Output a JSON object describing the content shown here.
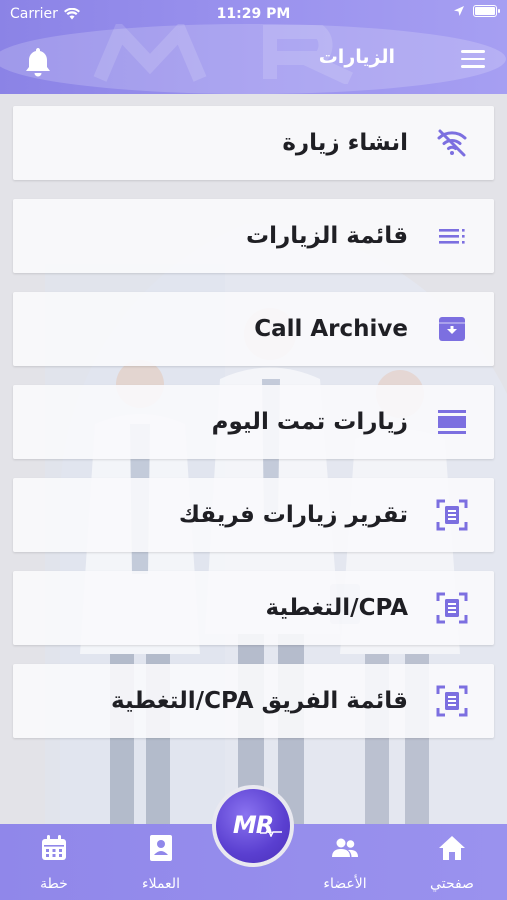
{
  "status_bar": {
    "carrier": "Carrier",
    "time": "11:29 PM"
  },
  "header": {
    "title": "الزيارات",
    "menu_icon": "hamburger-menu-icon",
    "bell_icon": "bell-icon",
    "brand_color": "#9a92ee"
  },
  "menu": {
    "items": [
      {
        "label": "انشاء زيارة",
        "icon": "wifi-off-icon"
      },
      {
        "label": "قائمة الزيارات",
        "icon": "list-icon"
      },
      {
        "label": "Call Archive",
        "icon": "archive-box-icon"
      },
      {
        "label": "زيارات تمت اليوم",
        "icon": "calendar-view-day-icon"
      },
      {
        "label": "تقرير زيارات فريقك",
        "icon": "document-scan-icon"
      },
      {
        "label": "CPA/التغطية",
        "icon": "document-scan-icon"
      },
      {
        "label": "قائمة الفريق CPA/التغطية",
        "icon": "document-scan-icon"
      }
    ],
    "icon_color": "#7c6fe0"
  },
  "bottom_nav": {
    "items": [
      {
        "label": "خطة",
        "icon": "calendar-icon"
      },
      {
        "label": "العملاء",
        "icon": "contact-card-icon"
      },
      {
        "label": "الأعضاء",
        "icon": "group-icon"
      },
      {
        "label": "صفحتي",
        "icon": "home-icon"
      }
    ],
    "center_logo": "MR"
  }
}
